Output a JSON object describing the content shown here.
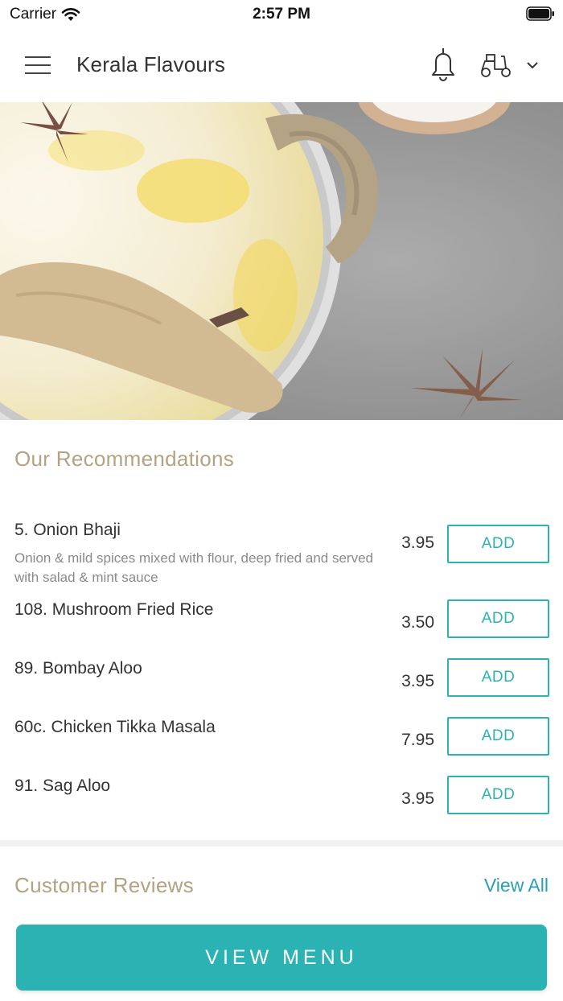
{
  "status_bar": {
    "carrier": "Carrier",
    "time": "2:57 PM"
  },
  "header": {
    "title": "Kerala Flavours",
    "icons": [
      "menu-icon",
      "bell-icon",
      "scooter-icon",
      "chevron-down-icon"
    ]
  },
  "recommendations": {
    "title": "Our Recommendations",
    "add_label": "ADD",
    "items": [
      {
        "name": "5. Onion Bhaji",
        "description": "Onion & mild spices mixed with flour, deep fried and served with salad & mint sauce",
        "price": "3.95"
      },
      {
        "name": "108. Mushroom Fried Rice",
        "description": "",
        "price": "3.50"
      },
      {
        "name": "89. Bombay Aloo",
        "description": "",
        "price": "3.95"
      },
      {
        "name": "60c. Chicken Tikka Masala",
        "description": "",
        "price": "7.95"
      },
      {
        "name": "91. Sag Aloo",
        "description": "",
        "price": "3.95"
      }
    ]
  },
  "reviews": {
    "title": "Customer Reviews",
    "view_all": "View All"
  },
  "cta": {
    "label": "VIEW MENU"
  },
  "colors": {
    "accent": "#2bb3b3",
    "section_title": "#b5a281",
    "link": "#2a9fb5"
  }
}
